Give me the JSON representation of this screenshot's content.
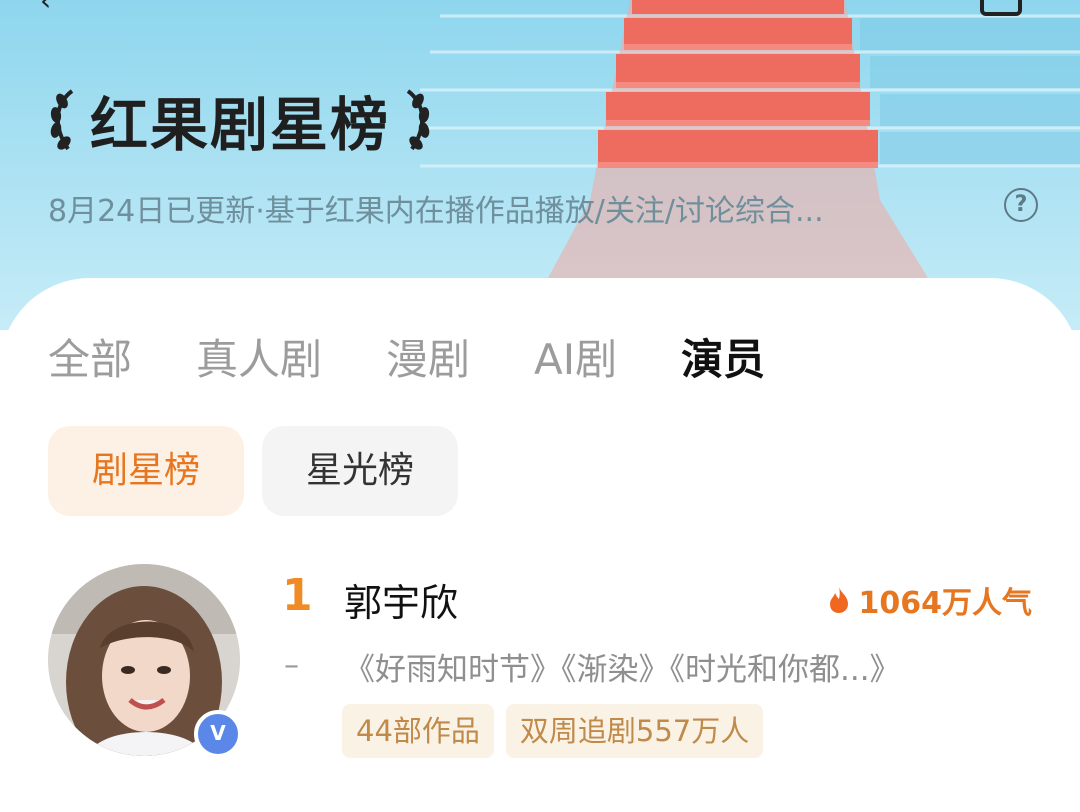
{
  "header": {
    "title": "红果剧星榜",
    "subtitle": "8月24日已更新·基于红果内在播作品播放/关注/讨论综合...",
    "help_icon": "question-circle-icon",
    "back_icon": "back-arrow-icon"
  },
  "tabs": [
    {
      "label": "全部",
      "active": false
    },
    {
      "label": "真人剧",
      "active": false
    },
    {
      "label": "漫剧",
      "active": false
    },
    {
      "label": "AI剧",
      "active": false
    },
    {
      "label": "演员",
      "active": true
    }
  ],
  "subtabs": [
    {
      "label": "剧星榜",
      "active": true
    },
    {
      "label": "星光榜",
      "active": false
    }
  ],
  "ranking": [
    {
      "rank": "1",
      "name": "郭宇欣",
      "popularity": "1064万人气",
      "rank_change": "–",
      "works": "《好雨知时节》《渐染》《时光和你都...》",
      "tags": [
        "44部作品",
        "双周追剧557万人"
      ],
      "verified_badge": "V"
    }
  ],
  "colors": {
    "accent": "#e6761f",
    "banner": "#a8e0f2",
    "tag_bg": "#fbf2e6",
    "tag_text": "#c08a4a"
  }
}
